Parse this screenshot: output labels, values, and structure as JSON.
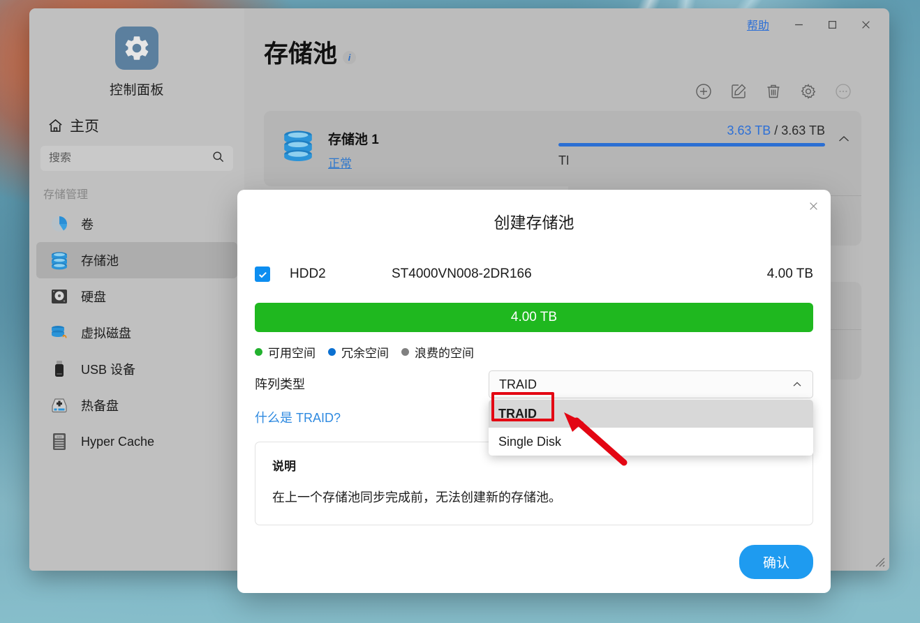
{
  "window": {
    "help_label": "帮助",
    "minimize_icon": "minimize-icon",
    "maximize_icon": "maximize-icon",
    "close_icon": "close-icon"
  },
  "sidebar": {
    "logo_icon": "gear-icon",
    "app_title": "控制面板",
    "home_icon": "home-icon",
    "home_label": "主页",
    "search": {
      "value": "",
      "placeholder": "搜索",
      "icon": "search-icon"
    },
    "group_label": "存储管理",
    "items": [
      {
        "label": "卷",
        "icon": "pie-chart-icon",
        "active": false
      },
      {
        "label": "存储池",
        "icon": "database-stack-icon",
        "active": true
      },
      {
        "label": "硬盘",
        "icon": "hard-disk-icon",
        "active": false
      },
      {
        "label": "虚拟磁盘",
        "icon": "virtual-disk-icon",
        "active": false
      },
      {
        "label": "USB 设备",
        "icon": "usb-drive-icon",
        "active": false
      },
      {
        "label": "热备盘",
        "icon": "hot-spare-icon",
        "active": false
      },
      {
        "label": "Hyper Cache",
        "icon": "ssd-cache-icon",
        "active": false
      }
    ]
  },
  "page": {
    "title": "存储池",
    "info_icon": "info-icon",
    "toolbar": [
      {
        "name": "create",
        "icon": "plus-circle-icon",
        "disabled": false
      },
      {
        "name": "edit",
        "icon": "edit-square-icon",
        "disabled": false
      },
      {
        "name": "delete",
        "icon": "trash-icon",
        "disabled": false
      },
      {
        "name": "settings",
        "icon": "gear-icon",
        "disabled": false
      },
      {
        "name": "more",
        "icon": "more-options-icon",
        "disabled": true
      }
    ],
    "pool": {
      "icon": "database-stack-icon",
      "name": "存储池 1",
      "status": "正常",
      "used": "3.63 TB",
      "separator": "/",
      "total": "3.63 TB",
      "usage_percent": 100,
      "raid_type": "TRAID",
      "collapse_icon": "chevron-up-icon"
    }
  },
  "modal": {
    "title": "创建存储池",
    "close_icon": "close-icon",
    "disk": {
      "checked": true,
      "name": "HDD2",
      "model": "ST4000VN008-2DR166",
      "size": "4.00 TB"
    },
    "allocation_bar": {
      "label": "4.00 TB",
      "color": "#1fb81f",
      "percent": 100
    },
    "legend": [
      {
        "label": "可用空间",
        "color": "#22b12e"
      },
      {
        "label": "冗余空间",
        "color": "#0b70d1"
      },
      {
        "label": "浪费的空间",
        "color": "#808080"
      }
    ],
    "array_type": {
      "label": "阵列类型",
      "value": "TRAID",
      "chevron_icon": "chevron-up-icon",
      "options": [
        {
          "label": "TRAID",
          "selected": true
        },
        {
          "label": "Single Disk",
          "selected": false
        }
      ]
    },
    "help_link": "什么是 TRAID?",
    "note": {
      "title": "说明",
      "text": "在上一个存储池同步完成前，无法创建新的存储池。"
    },
    "confirm_label": "确认"
  },
  "annotation": {
    "highlight_color": "#e30613",
    "target": "TRAID",
    "arrow_icon": "arrow-pointer-icon"
  }
}
